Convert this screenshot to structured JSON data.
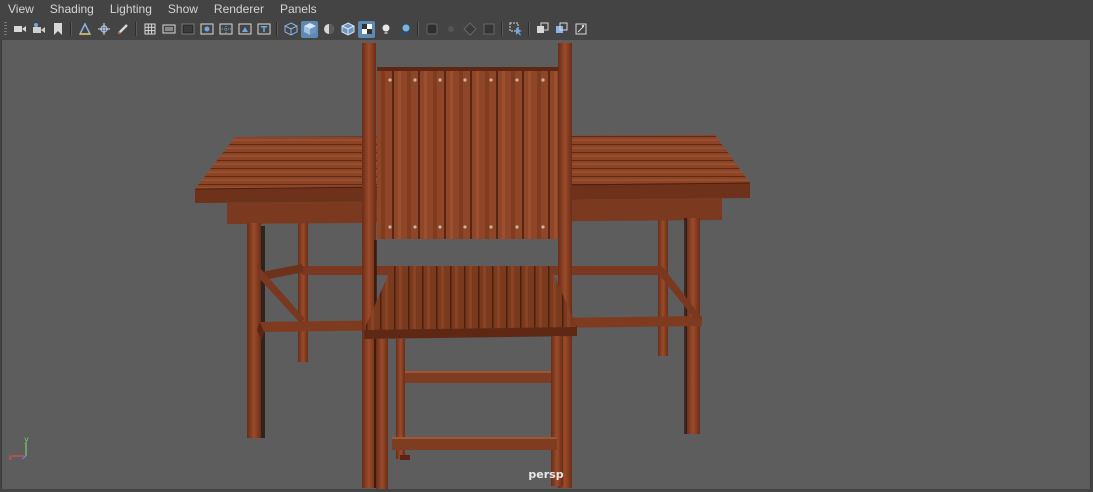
{
  "menubar": {
    "items": [
      "View",
      "Shading",
      "Lighting",
      "Show",
      "Renderer",
      "Panels"
    ]
  },
  "viewport": {
    "camera_label": "persp",
    "axis": {
      "y": "y",
      "x": "x"
    }
  },
  "colors": {
    "panel_bg": "#444444",
    "viewport_bg": "#5d5d5d",
    "active_button": "#5d89b3",
    "wood_dark": "#6b2e18",
    "wood_mid": "#8a4226",
    "wood_light": "#a0542f"
  },
  "toolbar": {
    "icons": [
      "camera-select-icon",
      "camera-attributes-icon",
      "bookmark-icon",
      "image-plane-icon",
      "2d-pan-zoom-icon",
      "grease-pencil-icon",
      "grid-icon",
      "film-gate-icon",
      "resolution-gate-icon",
      "gate-mask-icon",
      "field-chart-icon",
      "safe-action-icon",
      "safe-title-icon",
      "wireframe-icon",
      "smooth-shade-icon",
      "use-default-material-icon",
      "wireframe-on-shaded-icon",
      "textured-icon",
      "use-all-lights-icon",
      "shadows-icon",
      "screen-space-ao-icon",
      "motion-blur-icon",
      "multisample-aa-icon",
      "depth-of-field-icon",
      "isolate-select-icon",
      "xray-icon",
      "xray-joints-icon",
      "xray-components-icon"
    ]
  }
}
